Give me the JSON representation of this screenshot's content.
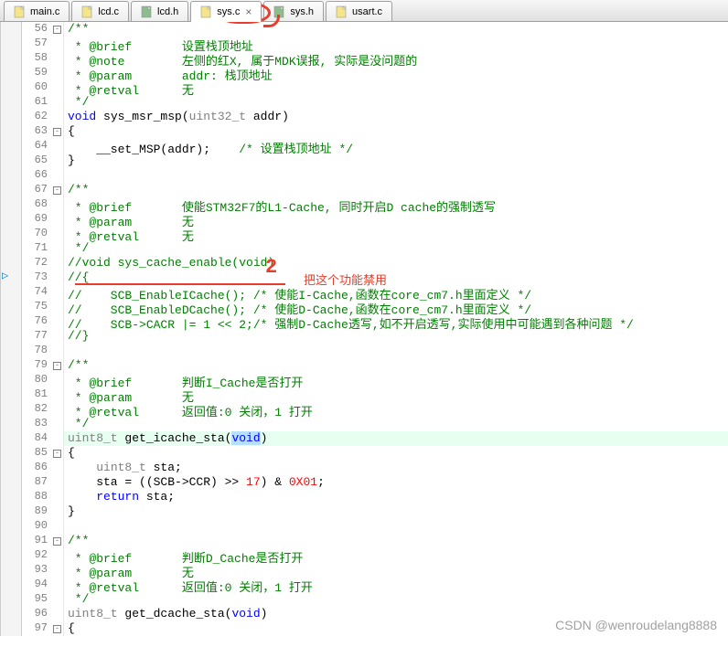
{
  "tabs": [
    {
      "label": "main.c",
      "icon": "c"
    },
    {
      "label": "lcd.c",
      "icon": "c"
    },
    {
      "label": "lcd.h",
      "icon": "h"
    },
    {
      "label": "sys.c",
      "icon": "c",
      "active": true,
      "closeable": true
    },
    {
      "label": "sys.h",
      "icon": "h"
    },
    {
      "label": "usart.c",
      "icon": "c"
    }
  ],
  "annotations": {
    "red_text_1": "2",
    "red_text_2": "把这个功能禁用"
  },
  "watermark": "CSDN @wenroudelang8888",
  "lines": [
    {
      "n": 56,
      "f": "[-]",
      "tokens": [
        {
          "t": "/**",
          "c": "comment"
        }
      ]
    },
    {
      "n": 57,
      "f": "|",
      "tokens": [
        {
          "t": " * @brief       设置栈顶地址",
          "c": "comment"
        }
      ]
    },
    {
      "n": 58,
      "f": "|",
      "tokens": [
        {
          "t": " * @note        左侧的红X, 属于MDK误报, 实际是没问题的",
          "c": "comment"
        }
      ]
    },
    {
      "n": 59,
      "f": "|",
      "tokens": [
        {
          "t": " * @param       addr: 栈顶地址",
          "c": "comment"
        }
      ]
    },
    {
      "n": 60,
      "f": "|",
      "tokens": [
        {
          "t": " * @retval      无",
          "c": "comment"
        }
      ]
    },
    {
      "n": 61,
      "f": "L",
      "tokens": [
        {
          "t": " */",
          "c": "comment"
        }
      ]
    },
    {
      "n": 62,
      "f": "",
      "tokens": [
        {
          "t": "void",
          "c": "kw"
        },
        {
          "t": " sys_msr_msp(",
          "c": ""
        },
        {
          "t": "uint32_t",
          "c": "pale"
        },
        {
          "t": " addr)",
          "c": ""
        }
      ]
    },
    {
      "n": 63,
      "f": "[-]",
      "tokens": [
        {
          "t": "{",
          "c": ""
        }
      ]
    },
    {
      "n": 64,
      "f": "|",
      "tokens": [
        {
          "t": "    __set_MSP(addr);    ",
          "c": ""
        },
        {
          "t": "/* 设置栈顶地址 */",
          "c": "comment"
        }
      ]
    },
    {
      "n": 65,
      "f": "L",
      "tokens": [
        {
          "t": "}",
          "c": ""
        }
      ]
    },
    {
      "n": 66,
      "f": "",
      "tokens": [
        {
          "t": "",
          "c": ""
        }
      ]
    },
    {
      "n": 67,
      "f": "[-]",
      "tokens": [
        {
          "t": "/**",
          "c": "comment"
        }
      ]
    },
    {
      "n": 68,
      "f": "|",
      "tokens": [
        {
          "t": " * @brief       使能STM32F7的L1-Cache, 同时开启D cache的强制透写",
          "c": "comment"
        }
      ]
    },
    {
      "n": 69,
      "f": "|",
      "tokens": [
        {
          "t": " * @param       无",
          "c": "comment"
        }
      ]
    },
    {
      "n": 70,
      "f": "|",
      "tokens": [
        {
          "t": " * @retval      无",
          "c": "comment"
        }
      ]
    },
    {
      "n": 71,
      "f": "L",
      "tokens": [
        {
          "t": " */",
          "c": "comment"
        }
      ]
    },
    {
      "n": 72,
      "f": "",
      "marker": "arrow",
      "tokens": [
        {
          "t": "//void sys_cache_enable(void)",
          "c": "comment"
        }
      ]
    },
    {
      "n": 73,
      "f": "",
      "tokens": [
        {
          "t": "//{",
          "c": "comment"
        }
      ]
    },
    {
      "n": 74,
      "f": "",
      "tokens": [
        {
          "t": "//    SCB_EnableICache(); /* 使能I-Cache,函数在core_cm7.h里面定义 */",
          "c": "comment"
        }
      ]
    },
    {
      "n": 75,
      "f": "",
      "tokens": [
        {
          "t": "//    SCB_EnableDCache(); /* 使能D-Cache,函数在core_cm7.h里面定义 */",
          "c": "comment"
        }
      ]
    },
    {
      "n": 76,
      "f": "",
      "tokens": [
        {
          "t": "//    SCB->CACR |= 1 << 2;/* 强制D-Cache透写,如不开启透写,实际使用中可能遇到各种问题 */",
          "c": "comment"
        }
      ]
    },
    {
      "n": 77,
      "f": "",
      "tokens": [
        {
          "t": "//}",
          "c": "comment"
        }
      ]
    },
    {
      "n": 78,
      "f": "",
      "tokens": [
        {
          "t": "",
          "c": ""
        }
      ]
    },
    {
      "n": 79,
      "f": "[-]",
      "tokens": [
        {
          "t": "/**",
          "c": "comment"
        }
      ]
    },
    {
      "n": 80,
      "f": "|",
      "tokens": [
        {
          "t": " * @brief       判断I_Cache是否打开",
          "c": "comment"
        }
      ]
    },
    {
      "n": 81,
      "f": "|",
      "tokens": [
        {
          "t": " * @param       无",
          "c": "comment"
        }
      ]
    },
    {
      "n": 82,
      "f": "|",
      "tokens": [
        {
          "t": " * @retval      返回值:0 关闭，1 打开",
          "c": "comment"
        }
      ]
    },
    {
      "n": 83,
      "f": "L",
      "tokens": [
        {
          "t": " */",
          "c": "comment"
        }
      ]
    },
    {
      "n": 84,
      "f": "",
      "hl": true,
      "tokens": [
        {
          "t": "uint8_t",
          "c": "pale"
        },
        {
          "t": " get_icache_sta",
          "c": ""
        },
        {
          "t": "(",
          "c": ""
        },
        {
          "t": "void",
          "c": "kw",
          "bg": "sel"
        },
        {
          "t": ")",
          "c": ""
        }
      ]
    },
    {
      "n": 85,
      "f": "[-]",
      "tokens": [
        {
          "t": "{",
          "c": ""
        }
      ]
    },
    {
      "n": 86,
      "f": "|",
      "tokens": [
        {
          "t": "    ",
          "c": ""
        },
        {
          "t": "uint8_t",
          "c": "pale"
        },
        {
          "t": " sta;",
          "c": ""
        }
      ]
    },
    {
      "n": 87,
      "f": "|",
      "tokens": [
        {
          "t": "    sta = ((SCB->CCR) >> ",
          "c": ""
        },
        {
          "t": "17",
          "c": "red"
        },
        {
          "t": ") & ",
          "c": ""
        },
        {
          "t": "0X01",
          "c": "red"
        },
        {
          "t": ";",
          "c": ""
        }
      ]
    },
    {
      "n": 88,
      "f": "|",
      "tokens": [
        {
          "t": "    ",
          "c": ""
        },
        {
          "t": "return",
          "c": "kw"
        },
        {
          "t": " sta;",
          "c": ""
        }
      ]
    },
    {
      "n": 89,
      "f": "L",
      "tokens": [
        {
          "t": "}",
          "c": ""
        }
      ]
    },
    {
      "n": 90,
      "f": "",
      "tokens": [
        {
          "t": "",
          "c": ""
        }
      ]
    },
    {
      "n": 91,
      "f": "[-]",
      "tokens": [
        {
          "t": "/**",
          "c": "comment"
        }
      ]
    },
    {
      "n": 92,
      "f": "|",
      "tokens": [
        {
          "t": " * @brief       判断D_Cache是否打开",
          "c": "comment"
        }
      ]
    },
    {
      "n": 93,
      "f": "|",
      "tokens": [
        {
          "t": " * @param       无",
          "c": "comment"
        }
      ]
    },
    {
      "n": 94,
      "f": "|",
      "tokens": [
        {
          "t": " * @retval      返回值:0 关闭，1 打开",
          "c": "comment"
        }
      ]
    },
    {
      "n": 95,
      "f": "L",
      "tokens": [
        {
          "t": " */",
          "c": "comment"
        }
      ]
    },
    {
      "n": 96,
      "f": "",
      "tokens": [
        {
          "t": "uint8_t",
          "c": "pale"
        },
        {
          "t": " get_dcache_sta(",
          "c": ""
        },
        {
          "t": "void",
          "c": "kw"
        },
        {
          "t": ")",
          "c": ""
        }
      ]
    },
    {
      "n": 97,
      "f": "[-]",
      "tokens": [
        {
          "t": "{",
          "c": ""
        }
      ]
    }
  ]
}
